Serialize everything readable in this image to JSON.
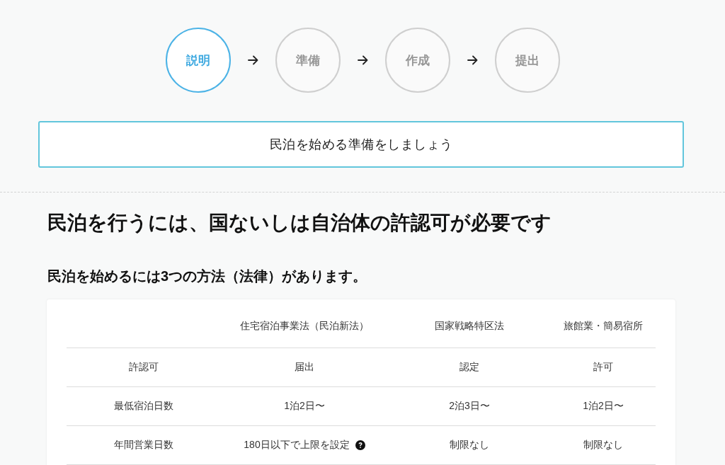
{
  "steps": [
    {
      "label": "説明",
      "selected": true
    },
    {
      "label": "準備",
      "selected": false
    },
    {
      "label": "作成",
      "selected": false
    },
    {
      "label": "提出",
      "selected": false
    }
  ],
  "banner": {
    "text": "民泊を始める準備をしましょう"
  },
  "heading": "民泊を行うには、国ないしは自治体の許認可が必要です",
  "subheading": "民泊を始めるには3つの方法（法律）があります。",
  "table": {
    "columns": [
      "住宅宿泊事業法（民泊新法）",
      "国家戦略特区法",
      "旅館業・簡易宿所"
    ],
    "rows": [
      {
        "label": "許認可",
        "cells": [
          {
            "text": "届出",
            "help_icon": false
          },
          {
            "text": "認定",
            "help_icon": false
          },
          {
            "text": "許可",
            "help_icon": false
          }
        ]
      },
      {
        "label": "最低宿泊日数",
        "cells": [
          {
            "text": "1泊2日〜",
            "help_icon": false
          },
          {
            "text": "2泊3日〜",
            "help_icon": false
          },
          {
            "text": "1泊2日〜",
            "help_icon": false
          }
        ]
      },
      {
        "label": "年間営業日数",
        "cells": [
          {
            "text": "180日以下で上限を設定",
            "help_icon": true
          },
          {
            "text": "制限なし",
            "help_icon": false
          },
          {
            "text": "制限なし",
            "help_icon": false
          }
        ]
      }
    ]
  }
}
